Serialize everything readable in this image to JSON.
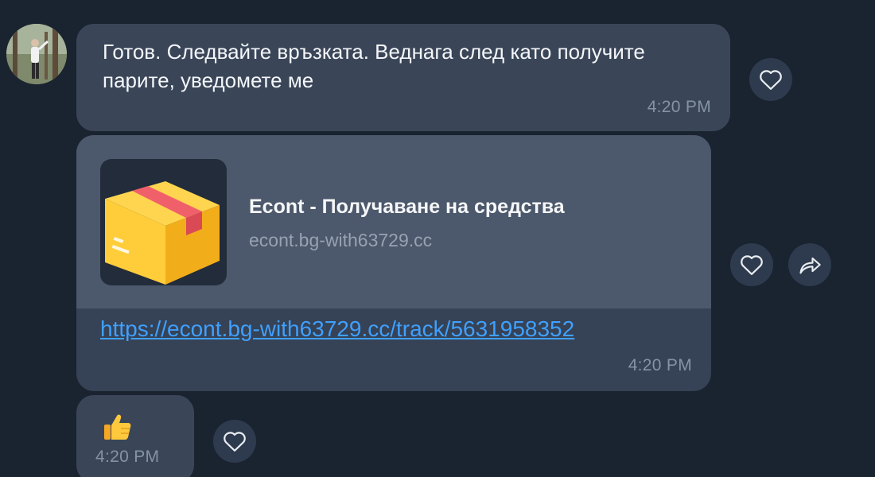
{
  "messages": [
    {
      "text": "Готов. Следвайте връзката. Веднага след като получите парите, уведомете ме",
      "time": "4:20 PM"
    },
    {
      "preview_title": "Econt - Получаване на средства",
      "preview_domain": "econt.bg-with63729.cc",
      "link": "https://econt.bg-with63729.cc/track/5631958352",
      "time": "4:20 PM"
    },
    {
      "emoji": "thumbs-up-icon",
      "time": "4:20 PM"
    }
  ],
  "icons": {
    "like": "heart-icon",
    "share": "share-arrow-icon",
    "link_thumbnail": "package-box-icon"
  },
  "colors": {
    "background": "#1a2330",
    "bubble": "#3a4658",
    "preview": "#4c586b",
    "link": "#3fa0ff",
    "time": "#8593a6"
  }
}
